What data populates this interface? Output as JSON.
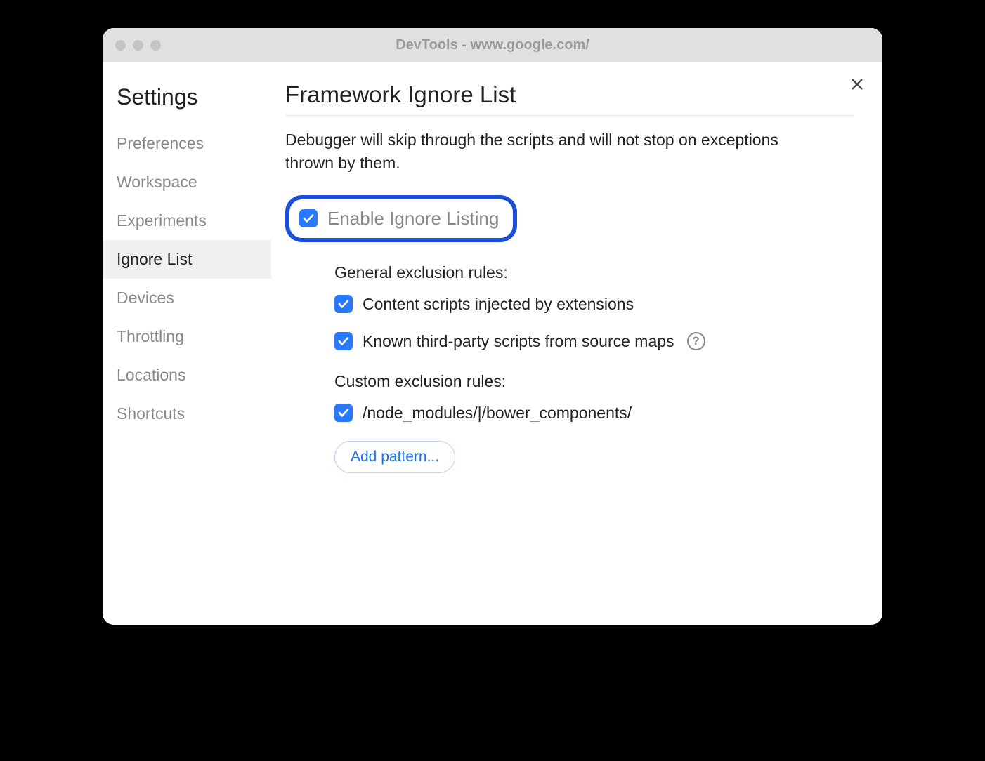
{
  "window": {
    "title": "DevTools - www.google.com/"
  },
  "sidebar": {
    "title": "Settings",
    "items": [
      {
        "label": "Preferences",
        "selected": false
      },
      {
        "label": "Workspace",
        "selected": false
      },
      {
        "label": "Experiments",
        "selected": false
      },
      {
        "label": "Ignore List",
        "selected": true
      },
      {
        "label": "Devices",
        "selected": false
      },
      {
        "label": "Throttling",
        "selected": false
      },
      {
        "label": "Locations",
        "selected": false
      },
      {
        "label": "Shortcuts",
        "selected": false
      }
    ]
  },
  "main": {
    "title": "Framework Ignore List",
    "description": "Debugger will skip through the scripts and will not stop on exceptions thrown by them.",
    "enable_label": "Enable Ignore Listing",
    "enable_checked": true,
    "general_section_title": "General exclusion rules:",
    "general_rules": [
      {
        "label": "Content scripts injected by extensions",
        "checked": true,
        "help": false
      },
      {
        "label": "Known third-party scripts from source maps",
        "checked": true,
        "help": true
      }
    ],
    "custom_section_title": "Custom exclusion rules:",
    "custom_rules": [
      {
        "label": "/node_modules/|/bower_components/",
        "checked": true
      }
    ],
    "add_pattern_label": "Add pattern..."
  }
}
